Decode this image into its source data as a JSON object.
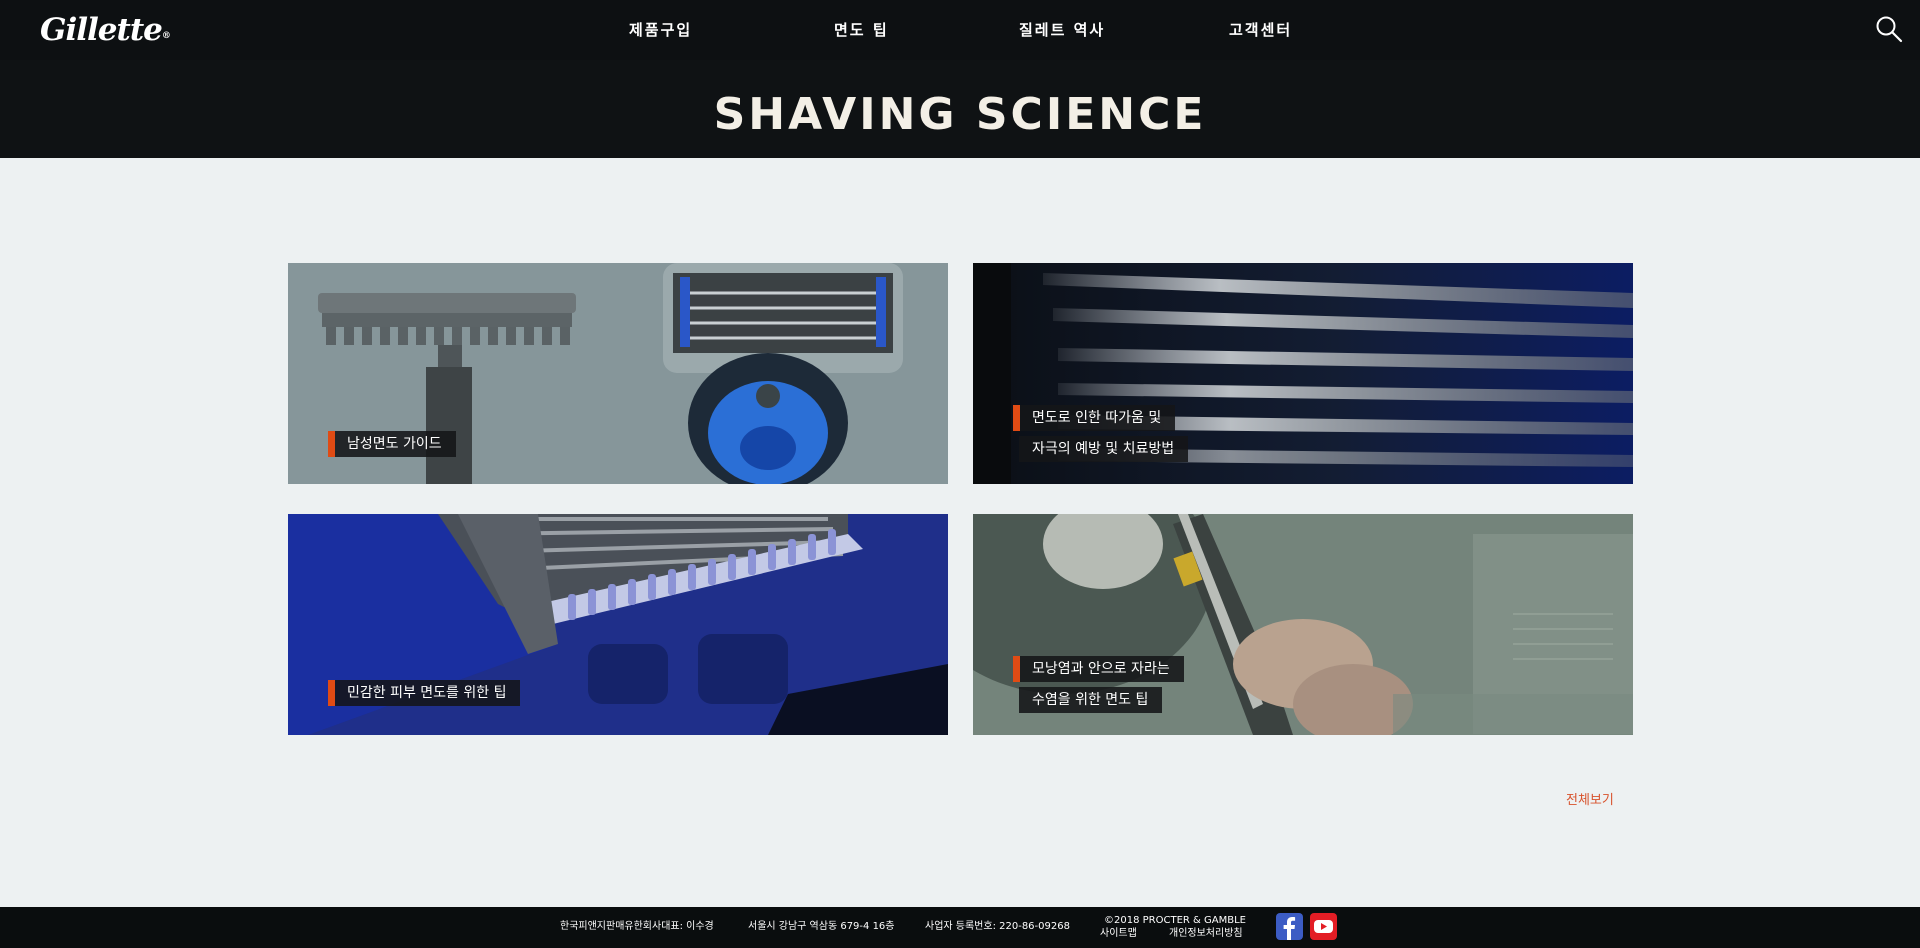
{
  "header": {
    "logo": "Gillette",
    "logo_mark": "®",
    "nav": [
      "제품구입",
      "면도 팁",
      "질레트 역사",
      "고객센터"
    ],
    "search_icon": "search-icon"
  },
  "banner": {
    "title": "SHAVING SCIENCE"
  },
  "cards": [
    {
      "lines": [
        "남성면도 가이드"
      ]
    },
    {
      "lines": [
        "면도로 인한 따가움 및",
        "자극의 예방 및 치료방법"
      ]
    },
    {
      "lines": [
        "민감한 피부 면도를 위한 팁"
      ]
    },
    {
      "lines": [
        "모낭염과 안으로 자라는",
        "수염을 위한 면도 팁"
      ]
    }
  ],
  "view_all": "전체보기",
  "footer": {
    "company": "한국피앤지판매유한회사대표: 이수경",
    "address": "서울시 강남구 역삼동 679-4 16층",
    "biz_no": "사업자 등록번호: 220-86-09268",
    "copyright": "©2018 PROCTER & GAMBLE",
    "sitemap": "사이트맵",
    "privacy": "개인정보처리방침",
    "facebook_icon": "facebook-icon",
    "youtube_icon": "youtube-icon"
  },
  "colors": {
    "accent": "#e04b14",
    "link": "#d8522c",
    "nav_bg": "#0d1012",
    "page_bg": "#edf1f2",
    "facebook": "#3c5cc4",
    "youtube": "#e31d25"
  }
}
